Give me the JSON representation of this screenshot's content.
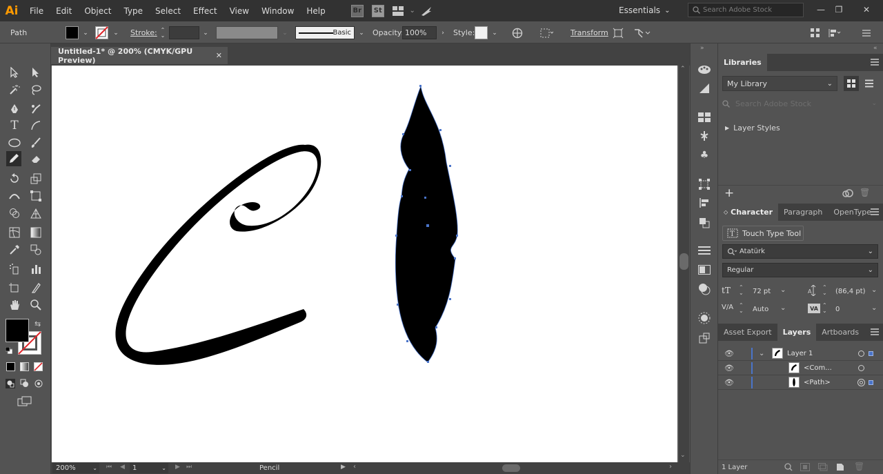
{
  "app": {
    "logo": "Ai"
  },
  "menu": [
    "File",
    "Edit",
    "Object",
    "Type",
    "Select",
    "Effect",
    "View",
    "Window",
    "Help"
  ],
  "menubar_badges": {
    "bridge": "Br",
    "stock": "St"
  },
  "workspace": {
    "label": "Essentials"
  },
  "stock_search": {
    "placeholder": "Search Adobe Stock"
  },
  "control": {
    "selection_type": "Path",
    "stroke_label": "Stroke:",
    "brush_label": "Basic",
    "opacity_label": "Opacity:",
    "opacity_value": "100%",
    "style_label": "Style:",
    "transform_label": "Transform"
  },
  "document": {
    "tab_title": "Untitled-1* @ 200% (CMYK/GPU Preview)"
  },
  "status": {
    "zoom": "200%",
    "artboard_num": "1",
    "tool": "Pencil"
  },
  "libraries": {
    "title": "Libraries",
    "library_name": "My Library",
    "search_placeholder": "Search Adobe Stock",
    "section": "Layer Styles"
  },
  "character": {
    "tabs": [
      "Character",
      "Paragraph",
      "OpenType"
    ],
    "touch_type": "Touch Type Tool",
    "font_family": "Atatürk",
    "font_style": "Regular",
    "font_size": "72 pt",
    "leading": "(86,4 pt)",
    "kerning": "Auto",
    "tracking": "0"
  },
  "layers": {
    "tabs": [
      "Asset Export",
      "Layers",
      "Artboards"
    ],
    "rows": [
      {
        "name": "Layer 1"
      },
      {
        "name": "<Com..."
      },
      {
        "name": "<Path>"
      }
    ],
    "footer": "1 Layer"
  },
  "colors": {
    "accent_blue": "#4a74c9",
    "app_orange": "#ff9a00",
    "ui_dark": "#323232",
    "ui_mid": "#535353"
  }
}
